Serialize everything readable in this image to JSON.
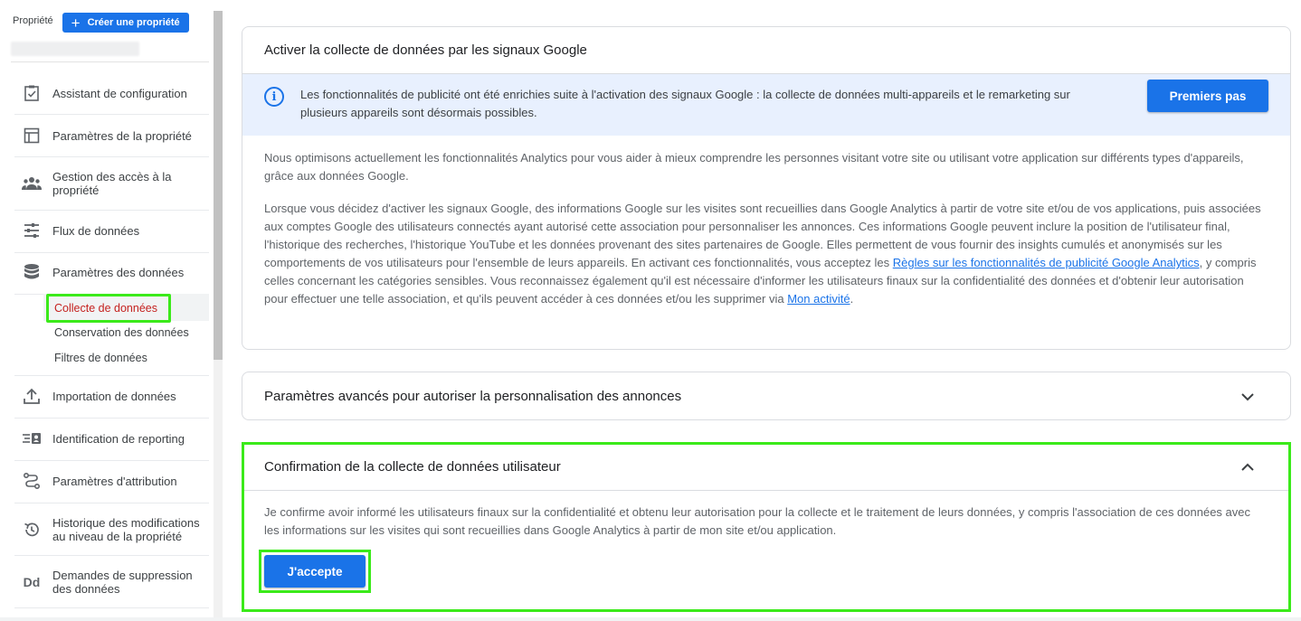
{
  "sidebar": {
    "property_label": "Propriété",
    "create_button": "Créer une propriété",
    "items": [
      {
        "label": "Assistant de configuration",
        "icon": "checklist-icon"
      },
      {
        "label": "Paramètres de la propriété",
        "icon": "layout-icon"
      },
      {
        "label": "Gestion des accès à la propriété",
        "icon": "people-icon"
      },
      {
        "label": "Flux de données",
        "icon": "streams-icon"
      },
      {
        "label": "Paramètres des données",
        "icon": "database-icon"
      },
      {
        "label": "Importation de données",
        "icon": "upload-icon"
      },
      {
        "label": "Identification de reporting",
        "icon": "reporting-id-icon"
      },
      {
        "label": "Paramètres d'attribution",
        "icon": "attribution-icon"
      },
      {
        "label": "Historique des modifications au niveau de la propriété",
        "icon": "history-icon"
      },
      {
        "label": "Demandes de suppression des données",
        "icon": "dd-icon"
      }
    ],
    "sub_items": [
      {
        "label": "Collecte de données"
      },
      {
        "label": "Conservation des données"
      },
      {
        "label": "Filtres de données"
      }
    ]
  },
  "signals_card": {
    "title": "Activer la collecte de données par les signaux Google",
    "info_text": "Les fonctionnalités de publicité ont été enrichies suite à l'activation des signaux Google : la collecte de données multi-appareils et le remarketing sur plusieurs appareils sont désormais possibles.",
    "button": "Premiers pas",
    "para1": "Nous optimisons actuellement les fonctionnalités Analytics pour vous aider à mieux comprendre les personnes visitant votre site ou utilisant votre application sur différents types d'appareils, grâce aux données Google.",
    "para2_start": "Lorsque vous décidez d'activer les signaux Google, des informations Google sur les visites sont recueillies dans Google Analytics à partir de votre site et/ou de vos applications, puis associées aux comptes Google des utilisateurs connectés ayant autorisé cette association pour personnaliser les annonces. Ces informations Google peuvent inclure la position de l'utilisateur final, l'historique des recherches, l'historique YouTube et les données provenant des sites partenaires de Google. Elles permettent de vous fournir des insights cumulés et anonymisés sur les comportements de vos utilisateurs pour l'ensemble de leurs appareils. En activant ces fonctionnalités, vous acceptez les ",
    "para2_link1": "Règles sur les fonctionnalités de publicité Google Analytics",
    "para2_mid": ", y compris celles concernant les catégories sensibles. Vous reconnaissez également qu'il est nécessaire d'informer les utilisateurs finaux sur la confidentialité des données et d'obtenir leur autorisation pour effectuer une telle association, et qu'ils peuvent accéder à ces données et/ou les supprimer via ",
    "para2_link2": "Mon activité",
    "para2_end": "."
  },
  "advanced_card": {
    "title": "Paramètres avancés pour autoriser la personnalisation des annonces"
  },
  "consent_card": {
    "title": "Confirmation de la collecte de données utilisateur",
    "text": "Je confirme avoir informé les utilisateurs finaux sur la confidentialité et obtenu leur autorisation pour la collecte et le traitement de leurs données, y compris l'association de ces données avec les informations sur les visites qui sont recueillies dans Google Analytics à partir de mon site et/ou application.",
    "button": "J'accepte"
  },
  "colors": {
    "accent": "#1a73e8",
    "highlight": "#3bea1a",
    "active_text": "#c5221f",
    "info_bg": "#e8f0fe"
  }
}
